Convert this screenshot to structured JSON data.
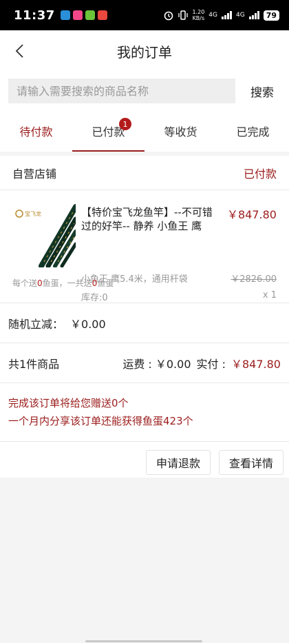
{
  "status_bar": {
    "time": "11:37",
    "net_speed_value": "1.20",
    "net_speed_unit": "KB/s",
    "network1": "4G",
    "network2": "4G",
    "battery": "79"
  },
  "header": {
    "title": "我的订单"
  },
  "search": {
    "placeholder": "请输入需要搜索的商品名称",
    "button_label": "搜索"
  },
  "tabs": [
    {
      "label": "待付款"
    },
    {
      "label": "已付款",
      "badge": "1"
    },
    {
      "label": "等收货"
    },
    {
      "label": "已完成"
    }
  ],
  "order": {
    "shop_name": "自营店铺",
    "status": "已付款",
    "product": {
      "title": "【特价宝飞龙鱼竿】--不可错过的好竿-- 静养 小鱼王 鹰",
      "price": "￥847.80",
      "spec": "小鱼王 鹰5.4米，通用杆袋",
      "original_price": "￥2826.00",
      "stock": "库存:0",
      "quantity": "x 1",
      "image_logo_text": "宝飞龙"
    },
    "gift_note_prefix": "每个送",
    "gift_note_each": "0",
    "gift_note_mid": "鱼蛋，一共送",
    "gift_note_total": "0",
    "gift_note_suffix": "鱼蛋",
    "discount_label": "随机立减：",
    "discount_value": "￥0.00",
    "item_count": "共1件商品",
    "shipping": "运费 : ￥0.00",
    "actual_paid_label": "实付 :",
    "actual_paid_value": "￥847.80",
    "reward_line1": "完成该订单将给您赠送0个",
    "reward_line2": "一个月内分享该订单还能获得鱼蛋423个",
    "refund_button": "申请退款",
    "detail_button": "查看详情"
  },
  "colors": {
    "accent": "#9b1c1c",
    "badge": "#b31b1b",
    "status_bar": "#000000"
  }
}
